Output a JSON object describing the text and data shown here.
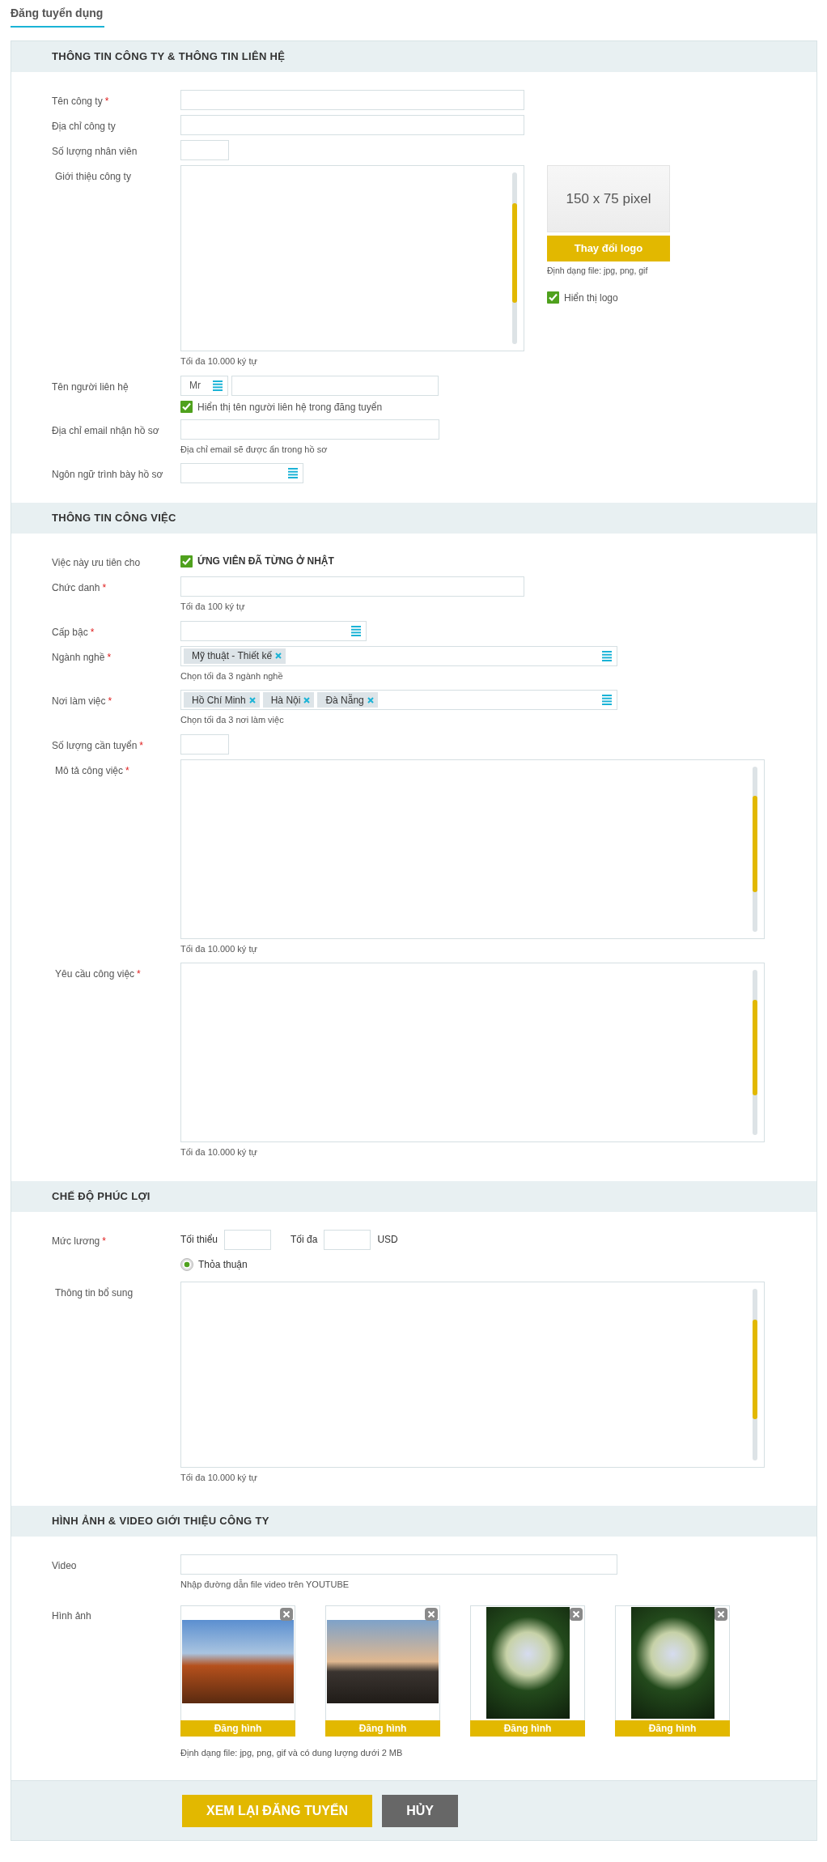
{
  "page_title": "Đăng tuyển dụng",
  "sections": [
    {
      "title": "THÔNG TIN CÔNG TY & THÔNG TIN LIÊN HỆ",
      "fields": [
        {
          "kind": "text",
          "label": "Tên công ty",
          "required_mark": "*"
        },
        {
          "kind": "text",
          "label": "Địa chỉ công ty"
        },
        {
          "kind": "number",
          "label": "Số lượng nhân viên"
        },
        {
          "kind": "textarea",
          "label": "Giới thiệu công ty",
          "hint": "Tối đa 10.000 ký tự",
          "logo": {
            "placeholder": "150 x 75 pixel",
            "button": "Thay đổi logo",
            "format": "Định dạng file: jpg, png, gif",
            "show_logo": {
              "label": "Hiển thị logo",
              "checked": true
            }
          }
        },
        {
          "kind": "contact",
          "label": "Tên người liên hệ",
          "title_value": "Mr",
          "checkbox": {
            "label": "Hiển thị tên người liên hệ trong đăng tuyển",
            "checked": true
          }
        },
        {
          "kind": "email",
          "label": "Địa chỉ email nhận hồ sơ",
          "hint": "Địa chỉ email sẽ được ẩn trong hồ sơ"
        },
        {
          "kind": "select_small",
          "label": "Ngôn ngữ trình bày hồ sơ"
        }
      ]
    },
    {
      "title": "THÔNG TIN CÔNG VIỆC",
      "fields": [
        {
          "kind": "checkbox",
          "label": "Việc này ưu tiên cho",
          "option": "ỨNG VIÊN ĐÃ TỪNG Ở NHẬT",
          "checked": true
        },
        {
          "kind": "text",
          "label": "Chức danh",
          "required_mark": "*",
          "hint": "Tối đa 100 ký tự"
        },
        {
          "kind": "select",
          "label": "Cấp bậc",
          "required_mark": "*"
        },
        {
          "kind": "tags",
          "label": "Ngành nghề",
          "required_mark": "*",
          "tags": [
            "Mỹ thuật - Thiết kế"
          ],
          "hint": "Chọn tối đa 3 ngành nghề"
        },
        {
          "kind": "tags",
          "label": "Nơi làm việc",
          "required_mark": "*",
          "tags": [
            "Hồ Chí Minh",
            "Hà Nội",
            "Đà Nẵng"
          ],
          "hint": "Chọn tối đa 3 nơi làm việc"
        },
        {
          "kind": "number",
          "label": "Số lượng cần tuyển",
          "required_mark": "*"
        },
        {
          "kind": "textarea",
          "label": "Mô tả công việc",
          "required_mark": "*",
          "hint": "Tối đa 10.000 ký tự"
        },
        {
          "kind": "textarea",
          "label": "Yêu cầu công việc",
          "required_mark": "*",
          "hint": "Tối đa 10.000 ký tự"
        }
      ]
    },
    {
      "title": "CHẾ ĐỘ PHÚC LỢI",
      "fields": [
        {
          "kind": "salary",
          "label": "Mức lương",
          "required_mark": "*",
          "min_label": "Tối thiểu",
          "max_label": "Tối đa",
          "currency": "USD",
          "negotiable": {
            "label": "Thỏa thuận",
            "selected": true
          }
        },
        {
          "kind": "textarea",
          "label": "Thông tin bổ sung",
          "hint": "Tối đa 10.000 ký tự"
        }
      ]
    },
    {
      "title": "HÌNH ẢNH & VIDEO GIỚI THIỆU CÔNG TY",
      "fields": [
        {
          "kind": "url",
          "label": "Video",
          "hint": "Nhập đường dẫn file video trên YOUTUBE"
        },
        {
          "kind": "images",
          "label": "Hình ảnh",
          "hint": "Định dạng file: jpg, png, gif và có dung lượng dưới 2 MB",
          "images": [
            {
              "kind": "landscape",
              "button": "Đăng hình"
            },
            {
              "kind": "landscape",
              "button": "Đăng hình"
            },
            {
              "kind": "portrait",
              "button": "Đăng hình"
            },
            {
              "kind": "portrait",
              "button": "Đăng hình"
            }
          ]
        }
      ]
    }
  ],
  "footer": {
    "buttons": [
      {
        "label": "XEM LẠI ĐĂNG TUYỂN",
        "kind": "primary"
      },
      {
        "label": "HỦY",
        "kind": "secondary"
      }
    ]
  }
}
